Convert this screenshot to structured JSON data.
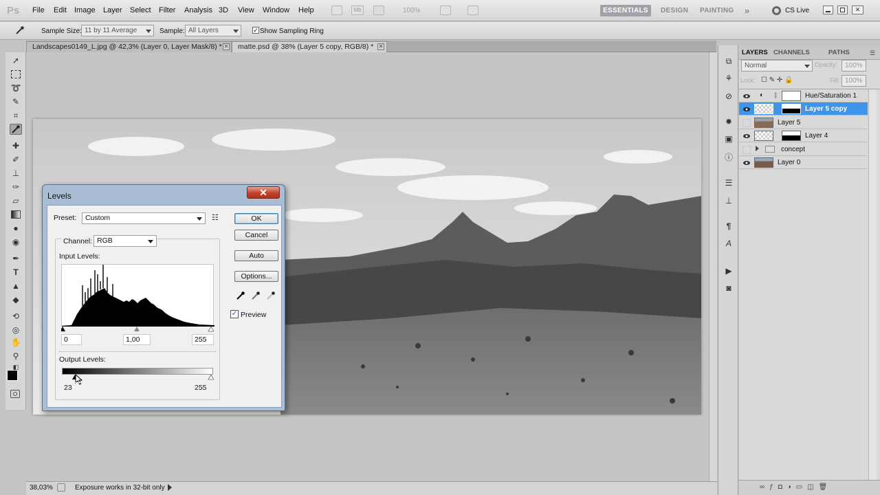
{
  "app": {
    "logo": "Ps"
  },
  "menu": [
    "File",
    "Edit",
    "Image",
    "Layer",
    "Select",
    "Filter",
    "Analysis",
    "3D",
    "View",
    "Window",
    "Help"
  ],
  "topbar": {
    "zoom": "100%",
    "workspaces": [
      "ESSENTIALS",
      "DESIGN",
      "PAINTING"
    ],
    "more": "»",
    "cslive": "CS Live"
  },
  "options": {
    "sample_size_label": "Sample Size:",
    "sample_size_value": "11 by 11 Average",
    "sample_label": "Sample:",
    "sample_value": "All Layers",
    "sampling_ring_label": "Show Sampling Ring",
    "sampling_ring_checked": true
  },
  "tabs": [
    {
      "label": "Landscapes0149_L.jpg @ 42,3% (Layer 0, Layer Mask/8) *",
      "active": false
    },
    {
      "label": "matte.psd @ 38% (Layer 5 copy, RGB/8) *",
      "active": true
    }
  ],
  "status": {
    "zoom": "38,03%",
    "info": "Exposure works in 32-bit only"
  },
  "layers_panel": {
    "tabs": [
      "LAYERS",
      "CHANNELS",
      "PATHS"
    ],
    "blend_mode": "Normal",
    "opacity_label": "Opacity:",
    "opacity": "100%",
    "lock_label": "Lock:",
    "fill_label": "Fill:",
    "fill": "100%",
    "layers": [
      {
        "name": "Hue/Saturation 1",
        "visible": true,
        "selected": false,
        "kind": "adjustment"
      },
      {
        "name": "Layer 5 copy",
        "visible": true,
        "selected": true,
        "kind": "masked"
      },
      {
        "name": "Layer 5",
        "visible": false,
        "selected": false,
        "kind": "image"
      },
      {
        "name": "Layer 4",
        "visible": true,
        "selected": false,
        "kind": "masked"
      },
      {
        "name": "concept",
        "visible": false,
        "selected": false,
        "kind": "group"
      },
      {
        "name": "Layer 0",
        "visible": true,
        "selected": false,
        "kind": "image"
      }
    ]
  },
  "levels": {
    "title": "Levels",
    "close": "✕",
    "preset_label": "Preset:",
    "preset_value": "Custom",
    "channel_label": "Channel:",
    "channel_value": "RGB",
    "input_label": "Input Levels:",
    "input_black": "0",
    "input_gamma": "1,00",
    "input_white": "255",
    "output_label": "Output Levels:",
    "output_black": "23",
    "output_white": "255",
    "buttons": {
      "ok": "OK",
      "cancel": "Cancel",
      "auto": "Auto",
      "options": "Options..."
    },
    "preview_label": "Preview",
    "preview_checked": true
  },
  "colors": {
    "selection": "#3e95e9",
    "close_red": "#c2422c",
    "essentials_bg": "#9fa3a8"
  }
}
